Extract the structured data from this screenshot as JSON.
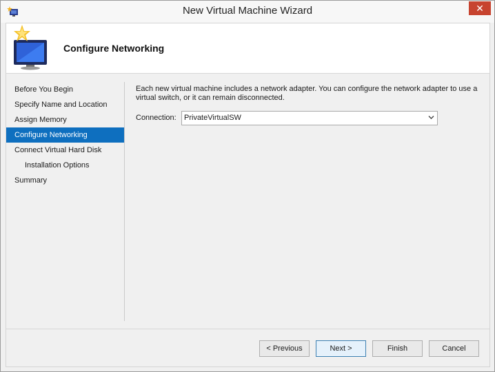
{
  "window": {
    "title": "New Virtual Machine Wizard"
  },
  "header": {
    "title": "Configure Networking"
  },
  "steps": [
    {
      "label": "Before You Begin",
      "active": false,
      "sub": false
    },
    {
      "label": "Specify Name and Location",
      "active": false,
      "sub": false
    },
    {
      "label": "Assign Memory",
      "active": false,
      "sub": false
    },
    {
      "label": "Configure Networking",
      "active": true,
      "sub": false
    },
    {
      "label": "Connect Virtual Hard Disk",
      "active": false,
      "sub": false
    },
    {
      "label": "Installation Options",
      "active": false,
      "sub": true
    },
    {
      "label": "Summary",
      "active": false,
      "sub": false
    }
  ],
  "content": {
    "line1": "Each new virtual machine includes a network adapter. You can configure the network adapter to use a",
    "line2": "virtual switch, or it can remain disconnected.",
    "connection_label": "Connection:",
    "connection_value": "PrivateVirtualSW"
  },
  "buttons": {
    "previous": "< Previous",
    "next": "Next >",
    "finish": "Finish",
    "cancel": "Cancel"
  },
  "colors": {
    "accent": "#0e6fbf",
    "close": "#c7432f"
  }
}
